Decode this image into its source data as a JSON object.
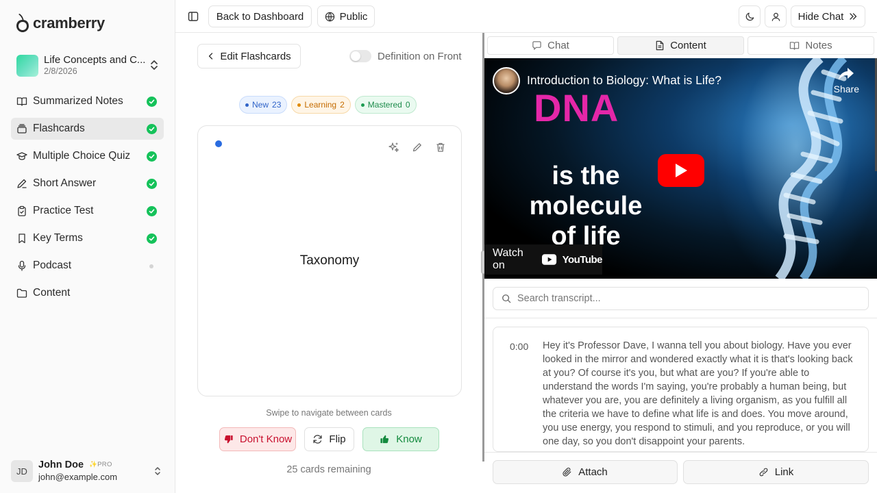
{
  "brand": {
    "name": "cramberry"
  },
  "project": {
    "title": "Life Concepts and C...",
    "date": "2/8/2026"
  },
  "sidebar": {
    "items": [
      {
        "label": "Summarized Notes",
        "status": "done"
      },
      {
        "label": "Flashcards",
        "status": "done"
      },
      {
        "label": "Multiple Choice Quiz",
        "status": "done"
      },
      {
        "label": "Short Answer",
        "status": "done"
      },
      {
        "label": "Practice Test",
        "status": "done"
      },
      {
        "label": "Key Terms",
        "status": "done"
      },
      {
        "label": "Podcast",
        "status": "pending"
      },
      {
        "label": "Content",
        "status": "none"
      }
    ],
    "active": "Flashcards"
  },
  "user": {
    "initials": "JD",
    "name": "John Doe",
    "plan": "PRO",
    "email": "john@example.com"
  },
  "topbar": {
    "back_label": "Back to Dashboard",
    "visibility_label": "Public",
    "hide_chat_label": "Hide Chat"
  },
  "flashcards": {
    "edit_label": "Edit Flashcards",
    "toggle_label": "Definition on Front",
    "toggle_on": false,
    "badges": {
      "new": {
        "label": "New",
        "count": "23"
      },
      "learning": {
        "label": "Learning",
        "count": "2"
      },
      "mastered": {
        "label": "Mastered",
        "count": "0"
      }
    },
    "card_term": "Taxonomy",
    "swipe_hint": "Swipe to navigate between cards",
    "dont_know_label": "Don't Know",
    "flip_label": "Flip",
    "know_label": "Know",
    "remaining": "25 cards remaining"
  },
  "right_panel": {
    "tabs": [
      {
        "label": "Chat",
        "active": false
      },
      {
        "label": "Content",
        "active": true
      },
      {
        "label": "Notes",
        "active": false
      }
    ],
    "video": {
      "title": "Introduction to Biology: What is Life?",
      "share_label": "Share",
      "thumb_big": "DNA",
      "thumb_line1": "is the",
      "thumb_line2": "molecule",
      "thumb_line3": "of life",
      "watch_on": "Watch on",
      "platform": "YouTube"
    },
    "search_placeholder": "Search transcript...",
    "transcript": [
      {
        "time": "0:00",
        "text": "Hey it's Professor Dave, I wanna tell you about biology. Have you ever looked in the mirror and wondered exactly what it is that's looking back at you? Of course it's you, but what are you? If you're able to understand the words I'm saying, you're probably a human being, but whatever you are, you are definitely a living organism, as you fulfill all the criteria we have to define what life is and does. You move around, you use energy, you respond to stimuli, and you reproduce, or you will one day, so you don't disappoint your parents."
      }
    ],
    "attach_label": "Attach",
    "link_label": "Link"
  },
  "colors": {
    "check": "#15c25a",
    "new": "#2f63c8",
    "learning": "#c46b00",
    "mastered": "#1d8b4b",
    "dont_know": "#c8102e",
    "know": "#138a3e"
  }
}
